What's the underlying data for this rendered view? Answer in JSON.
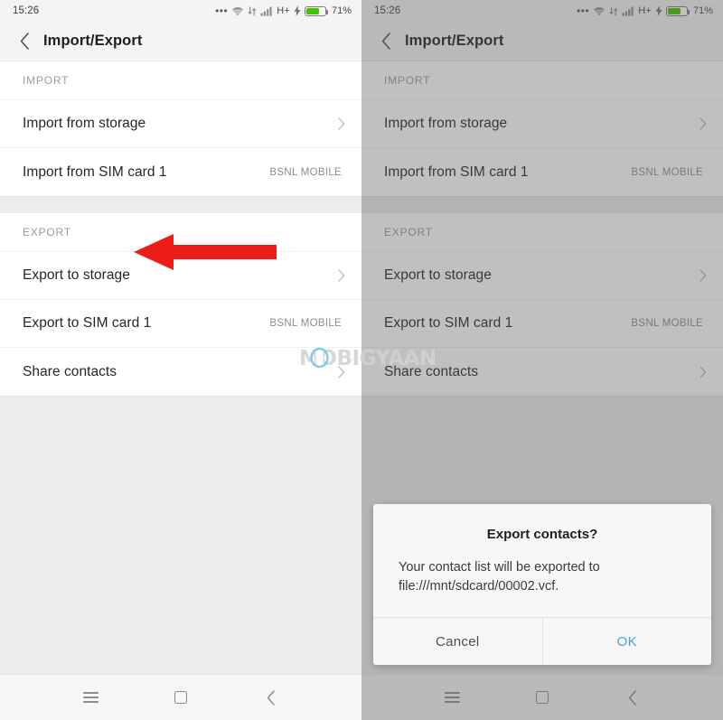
{
  "status_bar": {
    "clock": "15:26",
    "dots": "•••",
    "network_type": "H+",
    "battery_percent": "71%",
    "battery_level": 71,
    "icons": [
      "more-dots-icon",
      "wifi-icon",
      "data-transfer-icon",
      "signal-bars-icon",
      "charging-bolt-icon",
      "battery-icon"
    ]
  },
  "app_bar": {
    "title": "Import/Export",
    "back_icon": "chevron-left-icon"
  },
  "sections": [
    {
      "header": "IMPORT",
      "rows": [
        {
          "label": "Import from storage",
          "value": "",
          "accessory": "chevron-right-icon"
        },
        {
          "label": "Import from SIM card 1",
          "value": "BSNL MOBILE",
          "accessory": ""
        }
      ]
    },
    {
      "header": "EXPORT",
      "rows": [
        {
          "label": "Export to storage",
          "value": "",
          "accessory": "chevron-right-icon"
        },
        {
          "label": "Export to SIM card 1",
          "value": "BSNL MOBILE",
          "accessory": ""
        },
        {
          "label": "Share contacts",
          "value": "",
          "accessory": "chevron-right-icon"
        }
      ]
    }
  ],
  "nav_bar": {
    "menu_icon": "menu-hamburger-icon",
    "home_icon": "home-square-icon",
    "back_icon": "back-chevron-icon"
  },
  "dialog": {
    "title": "Export contacts?",
    "message": "Your contact list will be exported to file:///mnt/sdcard/00002.vcf.",
    "cancel_label": "Cancel",
    "ok_label": "OK"
  },
  "annotations": {
    "left_arrow_name": "red-arrow-pointing-to-export-to-storage",
    "down_arrow_name": "red-arrow-pointing-to-ok-button",
    "arrow_color": "#ee1c17"
  },
  "watermark": {
    "text": "MOBIGYAAN"
  },
  "colors": {
    "accent_blue": "#4aa3dd",
    "battery_green": "#41c300",
    "arrow_red": "#ee1c17",
    "panel_bg": "#ececec",
    "list_bg": "#ffffff"
  }
}
